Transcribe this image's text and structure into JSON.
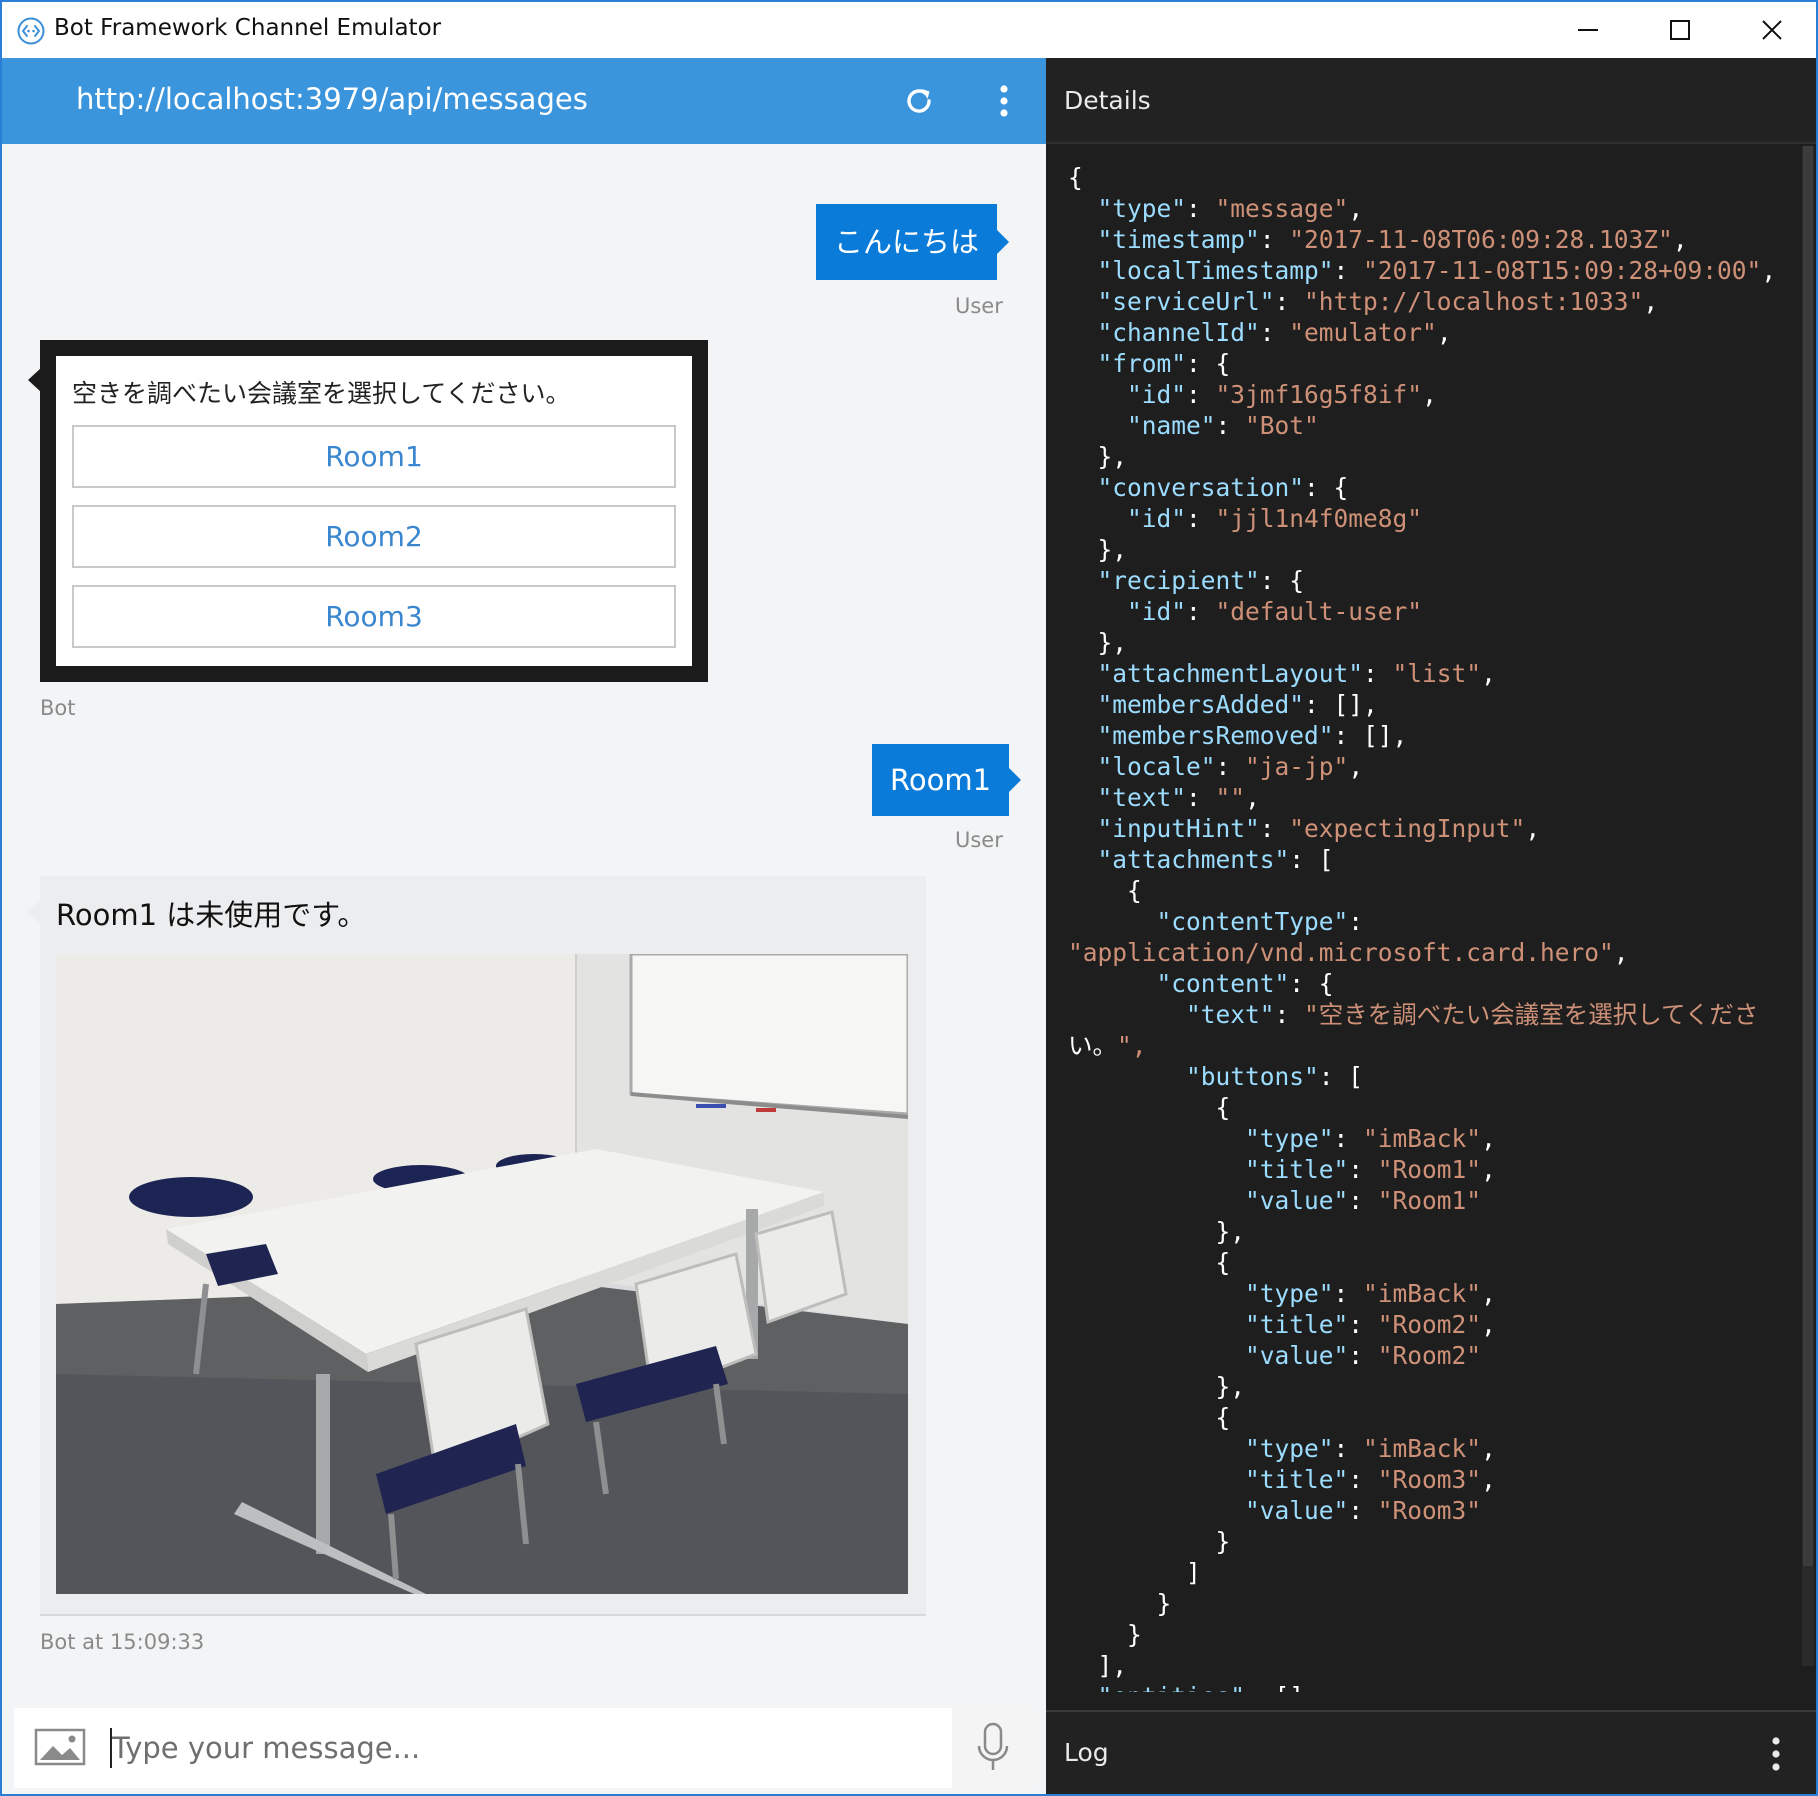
{
  "app": {
    "title": "Bot Framework Channel Emulator",
    "icon": "bot-emulator-icon",
    "accent": "#3b95dd"
  },
  "chat": {
    "endpoint": "http://localhost:3979/api/messages",
    "messages": [
      {
        "role": "user",
        "text": "こんにちは",
        "sender": "User"
      },
      {
        "role": "bot",
        "text": "空きを調べたい会議室を選択してください。",
        "buttons": [
          "Room1",
          "Room2",
          "Room3"
        ],
        "sender": "Bot"
      },
      {
        "role": "user",
        "text": "Room1",
        "sender": "User"
      },
      {
        "role": "bot",
        "text": "Room1 は未使用です。",
        "image": "meeting-room-photo",
        "sender": "Bot at 15:09:33"
      }
    ],
    "input": {
      "placeholder": "Type your message...",
      "value": ""
    }
  },
  "details": {
    "title": "Details",
    "json_lines": [
      "{",
      "  \"type\": \"message\",",
      "  \"timestamp\": \"2017-11-08T06:09:28.103Z\",",
      "  \"localTimestamp\": \"2017-11-08T15:09:28+09:00\",",
      "  \"serviceUrl\": \"http://localhost:1033\",",
      "  \"channelId\": \"emulator\",",
      "  \"from\": {",
      "    \"id\": \"3jmf16g5f8if\",",
      "    \"name\": \"Bot\"",
      "  },",
      "  \"conversation\": {",
      "    \"id\": \"jjl1n4f0me8g\"",
      "  },",
      "  \"recipient\": {",
      "    \"id\": \"default-user\"",
      "  },",
      "  \"attachmentLayout\": \"list\",",
      "  \"membersAdded\": [],",
      "  \"membersRemoved\": [],",
      "  \"locale\": \"ja-jp\",",
      "  \"text\": \"\",",
      "  \"inputHint\": \"expectingInput\",",
      "  \"attachments\": [",
      "    {",
      "      \"contentType\":",
      "\"application/vnd.microsoft.card.hero\",",
      "      \"content\": {",
      "        \"text\": \"空きを調べたい会議室を選択してくださ",
      "い。\",",
      "        \"buttons\": [",
      "          {",
      "            \"type\": \"imBack\",",
      "            \"title\": \"Room1\",",
      "            \"value\": \"Room1\"",
      "          },",
      "          {",
      "            \"type\": \"imBack\",",
      "            \"title\": \"Room2\",",
      "            \"value\": \"Room2\"",
      "          },",
      "          {",
      "            \"type\": \"imBack\",",
      "            \"title\": \"Room3\",",
      "            \"value\": \"Room3\"",
      "          }",
      "        ]",
      "      }",
      "    }",
      "  ],",
      "  \"entities\": []"
    ]
  },
  "log": {
    "title": "Log"
  },
  "colors": {
    "user_bubble": "#0a7bd8",
    "header_blue": "#3b95dd",
    "dark_panel": "#1e1e1e",
    "json_string": "#ce9178",
    "json_key": "#9cdcfe",
    "card_button_text": "#3b87cf"
  }
}
